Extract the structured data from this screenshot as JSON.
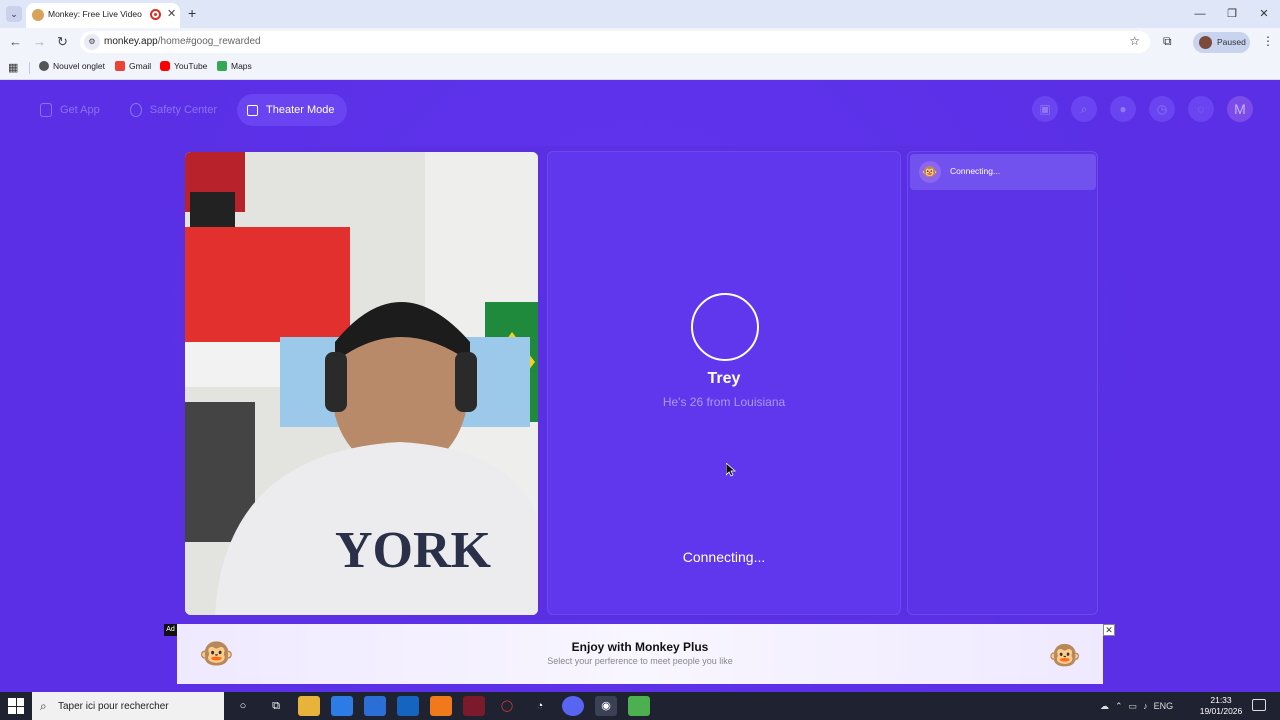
{
  "browser": {
    "tab_title": "Monkey: Free Live Video Ch",
    "url_host": "monkey.app",
    "url_path": "/home#goog_rewarded",
    "profile_label": "Paused",
    "bookmarks": [
      {
        "label": "Nouvel onglet",
        "icon": "new-tab-icon"
      },
      {
        "label": "Gmail",
        "icon": "gmail-icon"
      },
      {
        "label": "YouTube",
        "icon": "youtube-icon"
      },
      {
        "label": "Maps",
        "icon": "maps-icon"
      }
    ]
  },
  "nav": {
    "get_app": "Get App",
    "safety_center": "Safety Center",
    "theater_mode": "Theater Mode",
    "avatar_letter": "M"
  },
  "partner": {
    "name": "Trey",
    "info": "He's 26 from Louisiana",
    "status": "Connecting..."
  },
  "chat": {
    "status": "Connecting..."
  },
  "ad": {
    "label": "Ad",
    "title": "Enjoy with Monkey Plus",
    "subtitle": "Select your perference to meet people you like"
  },
  "taskbar": {
    "search_placeholder": "Taper ici pour rechercher",
    "language": "ENG",
    "time": "21:33",
    "date": "19/01/2026"
  },
  "colors": {
    "brand_purple": "#5b30e8",
    "accent": "#6a44f0"
  }
}
